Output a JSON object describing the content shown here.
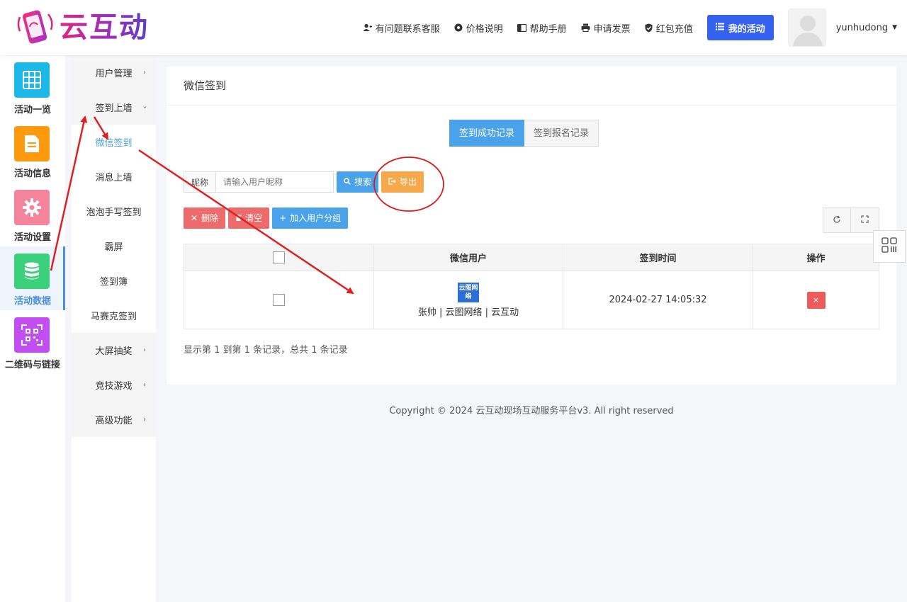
{
  "header": {
    "logo_text": "云互动",
    "nav": [
      {
        "label": "有问题联系客服",
        "icon": "user-plus-icon"
      },
      {
        "label": "价格说明",
        "icon": "gear-icon"
      },
      {
        "label": "帮助手册",
        "icon": "book-icon"
      },
      {
        "label": "申请发票",
        "icon": "printer-icon"
      },
      {
        "label": "红包充值",
        "icon": "shield-check-icon"
      }
    ],
    "primary_button": "我的活动",
    "username": "yunhudong"
  },
  "sidebar_main": [
    {
      "label": "活动一览",
      "icon": "grid-icon",
      "color": "#1cb8e8"
    },
    {
      "label": "活动信息",
      "icon": "document-icon",
      "color": "#ff9a0e"
    },
    {
      "label": "活动设置",
      "icon": "gear-icon",
      "color": "#f4839c"
    },
    {
      "label": "活动数据",
      "icon": "database-icon",
      "color": "#3ad07c",
      "active": true
    },
    {
      "label": "二维码与链接",
      "icon": "qrcode-icon",
      "color": "#c24df1"
    }
  ],
  "sidebar_sub": [
    {
      "label": "用户管理",
      "arrow": "›"
    },
    {
      "label": "签到上墙",
      "arrow": "›"
    },
    {
      "label": "微信签到",
      "active": true
    },
    {
      "label": "消息上墙"
    },
    {
      "label": "泡泡手写签到"
    },
    {
      "label": "霸屏"
    },
    {
      "label": "签到簿"
    },
    {
      "label": "马赛克签到"
    },
    {
      "label": "大屏抽奖",
      "arrow": "›"
    },
    {
      "label": "竞技游戏",
      "arrow": "›"
    },
    {
      "label": "高级功能",
      "arrow": "›"
    }
  ],
  "page": {
    "title": "微信签到",
    "tabs": [
      "签到成功记录",
      "签到报名记录"
    ],
    "search_label": "昵称",
    "search_placeholder": "请输入用户昵称",
    "search_button": "搜索",
    "export_button": "导出",
    "actions": {
      "delete": "删除",
      "clear": "清空",
      "add_group": "加入用户分组"
    },
    "table": {
      "headers": [
        "微信用户",
        "签到时间",
        "操作"
      ],
      "rows": [
        {
          "logo_text": "云图网络",
          "user": "张帅 | 云图网络 | 云互动",
          "time": "2024-02-27 14:05:32",
          "action": "×"
        }
      ]
    },
    "summary": "显示第 1 到第 1 条记录，总共 1 条记录"
  },
  "footer": "Copyright © 2024 云互动现场互动服务平台v3. All right reserved",
  "colors": {
    "primary": "#3561f0",
    "accent": "#4aa3ea",
    "orange": "#f7a84b",
    "red": "#ee6b6b"
  }
}
